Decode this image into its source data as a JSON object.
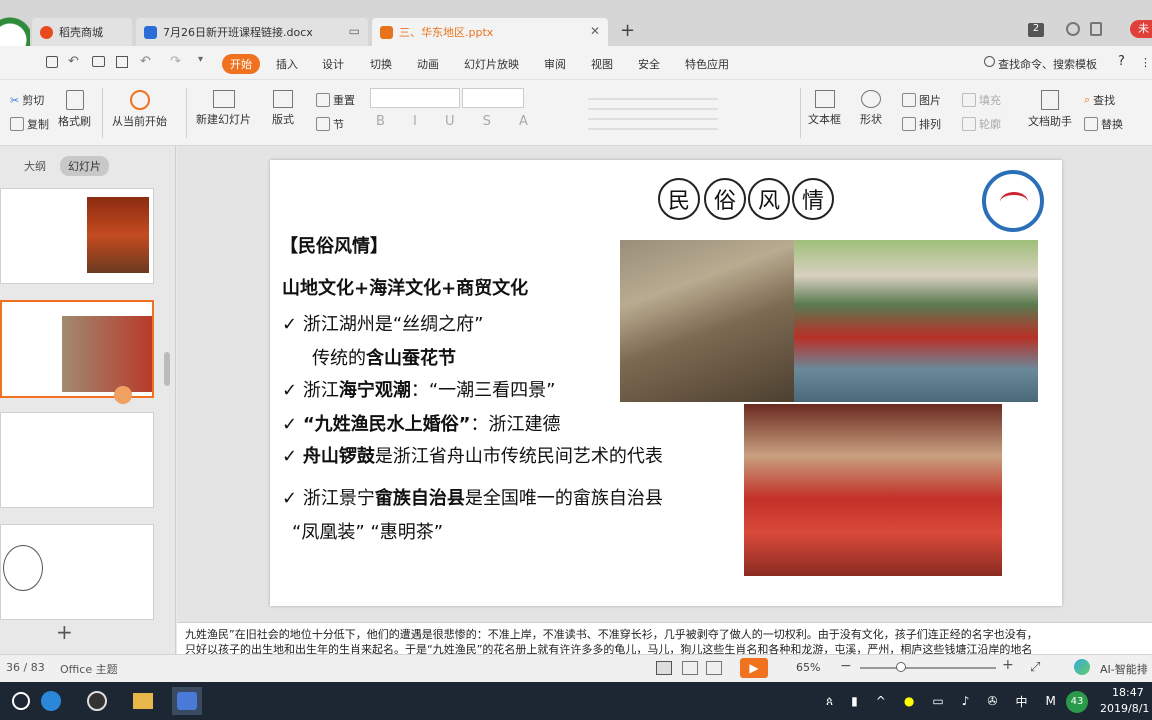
{
  "tabs": [
    {
      "label": "稻壳商城",
      "color": "#e8491d"
    },
    {
      "label": "7月26日新开班课程链接.docx",
      "color": "#2b6cd9"
    },
    {
      "label": "三、华东地区.pptx",
      "color": "#e8731d"
    }
  ],
  "tab_count": "2",
  "user_badge": "未",
  "menu": [
    "开始",
    "插入",
    "设计",
    "切换",
    "动画",
    "幻灯片放映",
    "审阅",
    "视图",
    "安全",
    "特色应用"
  ],
  "search_cmd": "查找命令、搜索模板",
  "ribbon": {
    "cut": "剪切",
    "copy": "复制",
    "format_painter": "格式刷",
    "from_current": "从当前开始",
    "new_slide": "新建幻灯片",
    "layout": "版式",
    "section": "节",
    "reset": "重置",
    "textbox": "文本框",
    "shape": "形状",
    "arrange": "排列",
    "picture": "图片",
    "fill": "填充",
    "outline": "轮廓",
    "doc_helper": "文档助手",
    "find": "查找",
    "replace": "替换"
  },
  "panel_tabs": {
    "outline": "大纲",
    "slides": "幻灯片"
  },
  "slide": {
    "title_chars": [
      "民",
      "俗",
      "风",
      "情"
    ],
    "heading": "【民俗风情】",
    "subheading": "山地文化+海洋文化+商贸文化",
    "line1_pre": "浙江湖州是“丝绸之府”",
    "line2_pre": "传统的",
    "line2_bold": "含山蚕花节",
    "line3_pre": "浙江",
    "line3_bold": "海宁观潮",
    "line3_post": "：“一潮三看四景”",
    "line4_bold": "“九姓渔民水上婚俗”",
    "line4_post": "：浙江建德",
    "line5_bold": "舟山锣鼓",
    "line5_post": "是浙江省舟山市传统民间艺术的代表",
    "line6_pre": "浙江景宁",
    "line6_bold": "畲族自治县",
    "line6_post": "是全国唯一的畲族自治县",
    "line7": "“凤凰装”  “惠明茶”",
    "check": "✓"
  },
  "notes_line1": "九姓渔民”在旧社会的地位十分低下，他们的遭遇是很悲惨的：不准上岸，不准读书、不准穿长衫，几乎被剥夺了做人的一切权利。由于没有文化，孩子们连正经的名字也没有，",
  "notes_line2": "只好以孩子的出生地和出生年的生肖来起名。于是“九姓渔民”的花名册上就有许许多多的龟儿，马儿，狗儿这些生肖名和各种和龙游，屯溪，严州，桐庐这些钱塘江沿岸的地名",
  "status": {
    "page": "36 / 83",
    "theme": "Office 主题",
    "zoom": "65%",
    "ai": "AI-智能排"
  },
  "taskbar": {
    "time": "18:47",
    "date": "2019/8/1",
    "ime": "中",
    "badge": "43"
  }
}
